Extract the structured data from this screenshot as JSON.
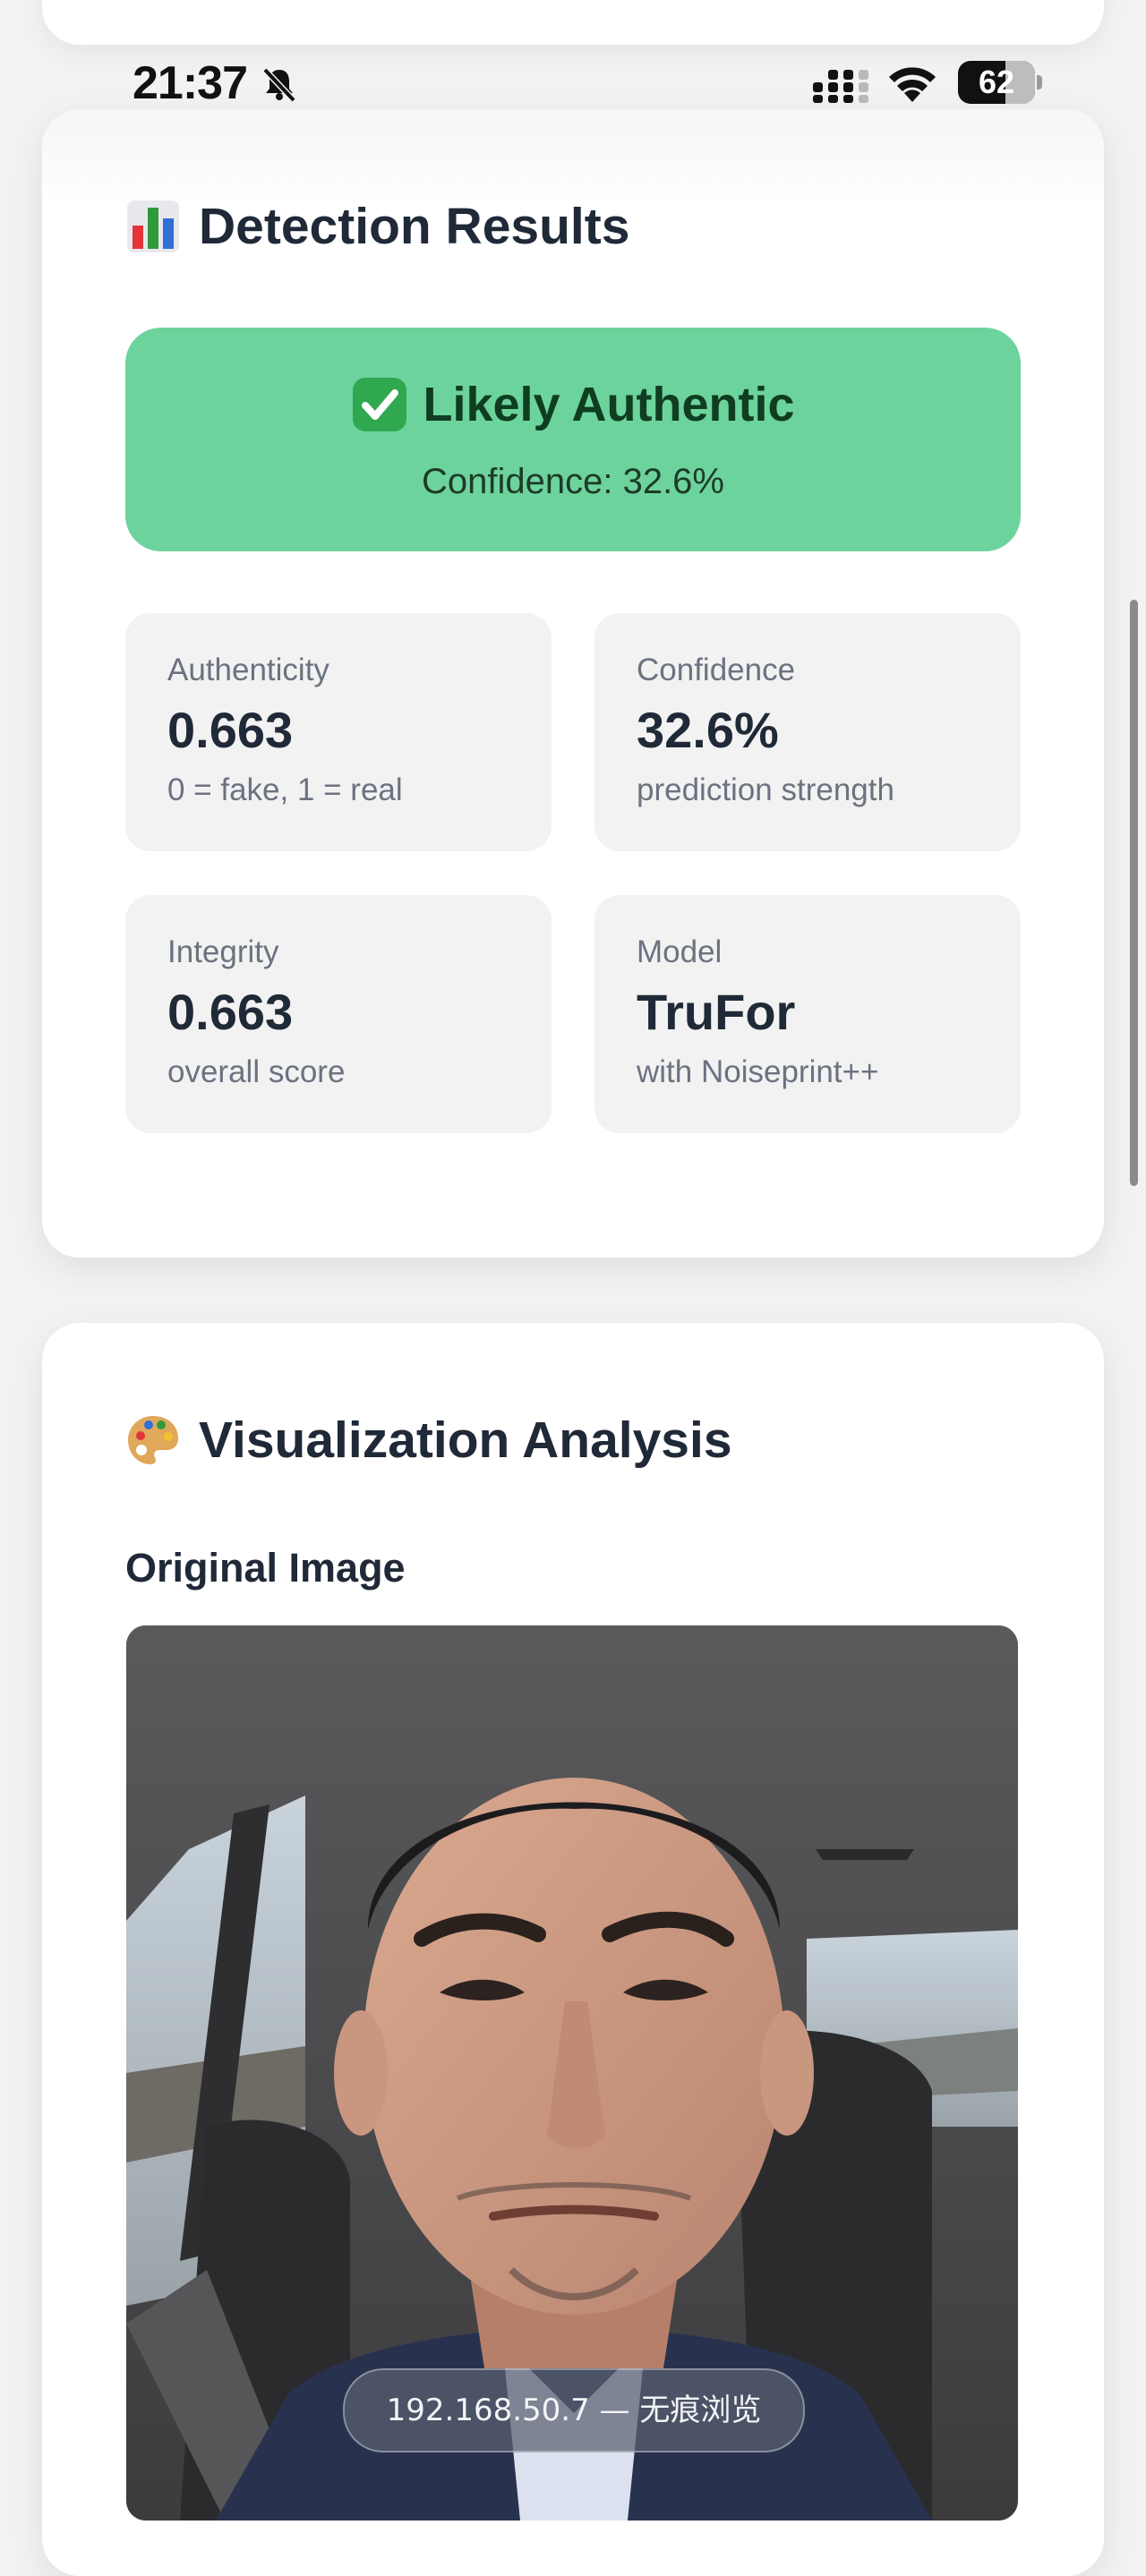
{
  "status_bar": {
    "time": "21:37",
    "battery_level": "62",
    "battery_percent": 62
  },
  "results": {
    "title": "Detection Results",
    "title_icon": "bar-chart-icon",
    "verdict": {
      "icon": "check-mark-icon",
      "label": "Likely Authentic",
      "confidence_text": "Confidence: 32.6%",
      "color": "#6dd39c"
    },
    "metrics": [
      {
        "label": "Authenticity",
        "value": "0.663",
        "note": "0 = fake, 1 = real"
      },
      {
        "label": "Confidence",
        "value": "32.6%",
        "note": "prediction strength"
      },
      {
        "label": "Integrity",
        "value": "0.663",
        "note": "overall score"
      },
      {
        "label": "Model",
        "value": "TruFor",
        "note": "with Noiseprint++"
      }
    ]
  },
  "visualization": {
    "title": "Visualization Analysis",
    "title_icon": "palette-icon",
    "original_image_label": "Original Image",
    "original_image_subject": "selfie-photo"
  },
  "browser": {
    "address": "192.168.50.7 — 无痕浏览"
  },
  "colors": {
    "page_background": "#f2f2f4",
    "card_background": "#ffffff",
    "tile_background": "#f2f2f2",
    "text_primary": "#1f2937",
    "text_secondary": "#6b7280"
  }
}
